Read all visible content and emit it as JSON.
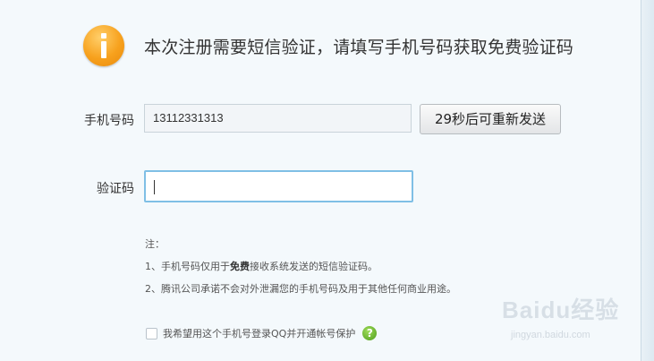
{
  "message": "本次注册需要短信验证，请填写手机号码获取免费验证码",
  "phone": {
    "label": "手机号码",
    "value": "13112331313"
  },
  "resend_button": "29秒后可重新发送",
  "code": {
    "label": "验证码",
    "value": ""
  },
  "notes": {
    "title": "注：",
    "item1_pre": "1、手机号码仅用于",
    "item1_bold": "免费",
    "item1_post": "接收系统发送的短信验证码。",
    "item2": "2、腾讯公司承诺不会对外泄漏您的手机号码及用于其他任何商业用途。"
  },
  "checkbox_label": "我希望用这个手机号登录QQ并开通帐号保护",
  "watermark": "Baidu经验",
  "watermark_sub": "jingyan.baidu.com",
  "colors": {
    "info_icon": "#f7a11d",
    "focus_border": "#7fbfe5",
    "help_icon": "#5aa824"
  }
}
